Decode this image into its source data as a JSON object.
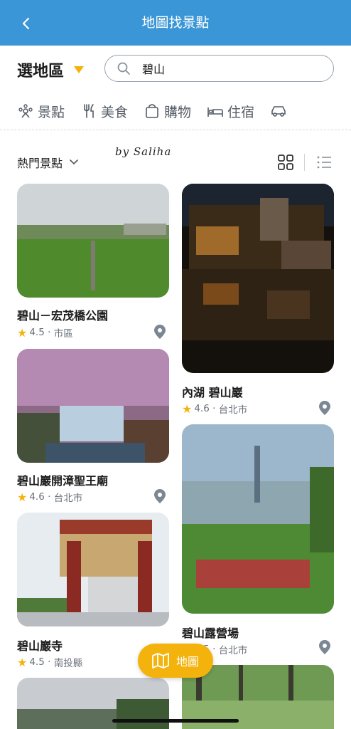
{
  "header": {
    "title": "地圖找景點",
    "back_icon": "chevron-left-icon"
  },
  "region": {
    "label": "選地區"
  },
  "search": {
    "value": "碧山",
    "placeholder": ""
  },
  "categories": [
    {
      "label": "景點",
      "icon": "attraction-icon"
    },
    {
      "label": "美食",
      "icon": "fork-knife-icon"
    },
    {
      "label": "購物",
      "icon": "shopping-bag-icon"
    },
    {
      "label": "住宿",
      "icon": "bed-icon"
    }
  ],
  "filter": {
    "label": "熱門景點"
  },
  "signature": "by Saliha",
  "cards": [
    {
      "name": "碧山－宏茂橋公園",
      "rating": "4.5",
      "location": "市區"
    },
    {
      "name": "內湖 碧山巖",
      "rating": "4.6",
      "location": "台北市"
    },
    {
      "name": "碧山巖開漳聖王廟",
      "rating": "4.6",
      "location": "台北市"
    },
    {
      "name": "碧山露營場",
      "rating": "4.5",
      "location": "台北市"
    },
    {
      "name": "碧山巖寺",
      "rating": "4.5",
      "location": "南投縣"
    }
  ],
  "map_button": {
    "label": "地圖"
  },
  "colors": {
    "header": "#3a96d6",
    "accent": "#f4b30c"
  }
}
